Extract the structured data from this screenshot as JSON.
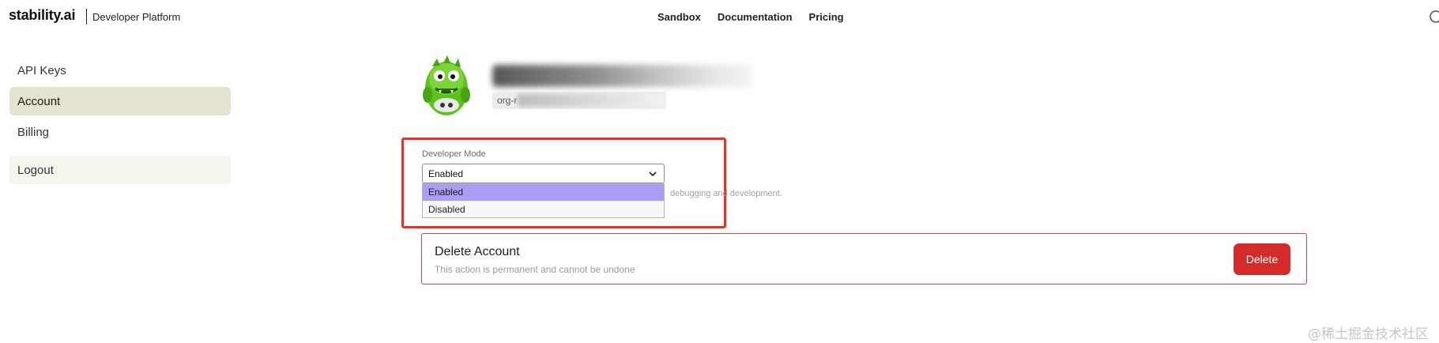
{
  "header": {
    "logo_text": "stability.ai",
    "platform": "Developer Platform",
    "nav": [
      {
        "label": "Sandbox"
      },
      {
        "label": "Documentation"
      },
      {
        "label": "Pricing"
      }
    ],
    "search_icon": "search-icon"
  },
  "sidebar": {
    "items": [
      {
        "label": "API Keys",
        "active": false
      },
      {
        "label": "Account",
        "active": true
      },
      {
        "label": "Billing",
        "active": false
      }
    ],
    "logout_label": "Logout",
    "active_color": "#e4e3cf"
  },
  "profile": {
    "avatar_icon": "green-monster-avatar",
    "org_prefix": "org-r"
  },
  "developer_mode": {
    "label": "Developer Mode",
    "value": "Enabled",
    "options": [
      {
        "label": "Enabled",
        "selected": true
      },
      {
        "label": "Disabled",
        "selected": false
      }
    ],
    "help_text": "debugging and development.",
    "highlight_color": "#e0342b",
    "selected_color": "#ad9cf6"
  },
  "delete_account": {
    "title": "Delete Account",
    "subtitle": "This action is permanent and cannot be undone",
    "button_label": "Delete",
    "button_color": "#d42a2a"
  },
  "watermark": "@稀土掘金技术社区"
}
